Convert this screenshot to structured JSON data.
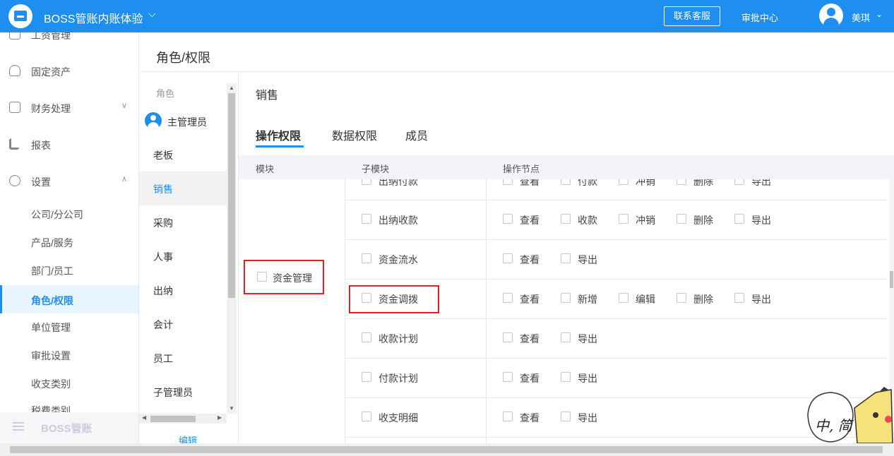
{
  "header": {
    "app_title": "BOSS管账内账体验",
    "contact_button": "联系客服",
    "approval_link": "审批中心",
    "username": "美琪"
  },
  "sidebar": {
    "items": [
      {
        "label": "工资管理",
        "icon": "salary-icon"
      },
      {
        "label": "固定资产",
        "icon": "asset-icon"
      },
      {
        "label": "财务处理",
        "icon": "finance-icon"
      },
      {
        "label": "报表",
        "icon": "chart-icon"
      },
      {
        "label": "设置",
        "icon": "gear-icon"
      }
    ],
    "settings_children": [
      "公司/分公司",
      "产品/服务",
      "部门/员工",
      "角色/权限",
      "单位管理",
      "审批设置",
      "收支类别",
      "税费类别"
    ],
    "active_child": "角色/权限",
    "footer_brand": "BOSS管账"
  },
  "page": {
    "title": "角色/权限"
  },
  "roles": {
    "header": "角色",
    "admin": "主管理员",
    "items": [
      "老板",
      "销售",
      "采购",
      "人事",
      "出纳",
      "会计",
      "员工",
      "子管理员"
    ],
    "active": "销售",
    "edit_label": "编辑"
  },
  "permissions": {
    "role_title": "销售",
    "tabs": [
      "操作权限",
      "数据权限",
      "成员"
    ],
    "active_tab": "操作权限",
    "columns": [
      "模块",
      "子模块",
      "操作节点"
    ],
    "module": "资金管理",
    "rows": [
      {
        "submodule": "出纳付款",
        "actions": [
          "查看",
          "付款",
          "冲销",
          "删除",
          "导出"
        ]
      },
      {
        "submodule": "出纳收款",
        "actions": [
          "查看",
          "收款",
          "冲销",
          "删除",
          "导出"
        ]
      },
      {
        "submodule": "资金流水",
        "actions": [
          "查看",
          "导出"
        ]
      },
      {
        "submodule": "资金调拨",
        "actions": [
          "查看",
          "新增",
          "编辑",
          "删除",
          "导出"
        ]
      },
      {
        "submodule": "收款计划",
        "actions": [
          "查看",
          "导出"
        ]
      },
      {
        "submodule": "付款计划",
        "actions": [
          "查看",
          "导出"
        ]
      },
      {
        "submodule": "收支明细",
        "actions": [
          "查看",
          "导出"
        ]
      }
    ]
  },
  "overlay_text": "中, 简",
  "colors": {
    "primary": "#1e8ff0",
    "highlight_box": "#e02020",
    "active_bg": "#e8f4fe"
  }
}
